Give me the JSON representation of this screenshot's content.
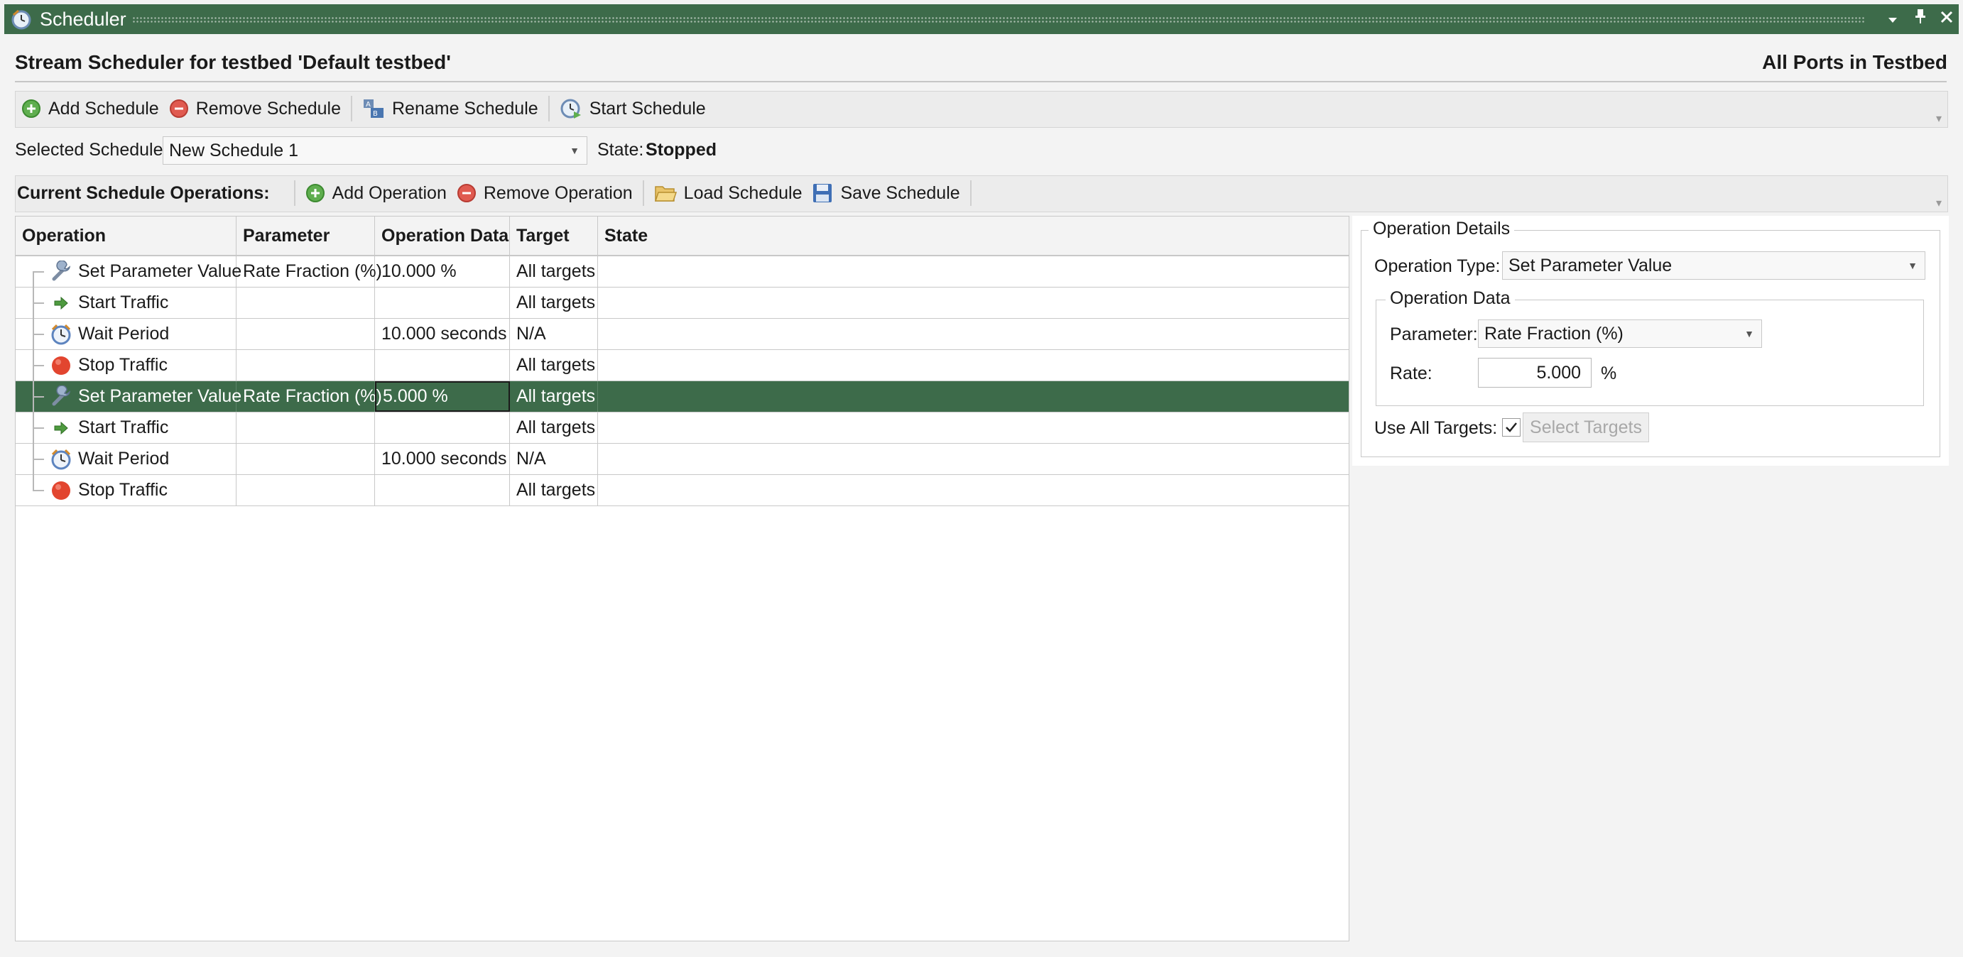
{
  "window": {
    "title": "Scheduler",
    "icon": "scheduler-clock-icon"
  },
  "header": {
    "title": "Stream Scheduler for testbed 'Default testbed'",
    "scope": "All Ports in Testbed"
  },
  "schedule_toolbar": {
    "add": "Add Schedule",
    "remove": "Remove Schedule",
    "rename": "Rename Schedule",
    "start": "Start Schedule"
  },
  "selection": {
    "label": "Selected Schedule:",
    "value": "New Schedule 1",
    "state_label": "State:",
    "state_value": "Stopped"
  },
  "operations_toolbar": {
    "label": "Current Schedule Operations:",
    "add": "Add Operation",
    "remove": "Remove Operation",
    "load": "Load Schedule",
    "save": "Save Schedule"
  },
  "grid": {
    "columns": [
      "Operation",
      "Parameter",
      "Operation Data",
      "Target",
      "State"
    ],
    "rows": [
      {
        "icon": "wrench-icon",
        "operation": "Set Parameter Value",
        "parameter": "Rate Fraction (%)",
        "data": "10.000 %",
        "target": "All targets",
        "state": ""
      },
      {
        "icon": "green-arrow-icon",
        "operation": "Start Traffic",
        "parameter": "",
        "data": "",
        "target": "All targets",
        "state": ""
      },
      {
        "icon": "alarm-clock-icon",
        "operation": "Wait Period",
        "parameter": "",
        "data": "10.000 seconds",
        "target": "N/A",
        "state": ""
      },
      {
        "icon": "stop-red-icon",
        "operation": "Stop Traffic",
        "parameter": "",
        "data": "",
        "target": "All targets",
        "state": ""
      },
      {
        "icon": "wrench-icon",
        "operation": "Set Parameter Value",
        "parameter": "Rate Fraction (%)",
        "data": "5.000 %",
        "target": "All targets",
        "state": "",
        "selected": true
      },
      {
        "icon": "green-arrow-icon",
        "operation": "Start Traffic",
        "parameter": "",
        "data": "",
        "target": "All targets",
        "state": ""
      },
      {
        "icon": "alarm-clock-icon",
        "operation": "Wait Period",
        "parameter": "",
        "data": "10.000 seconds",
        "target": "N/A",
        "state": ""
      },
      {
        "icon": "stop-red-icon",
        "operation": "Stop Traffic",
        "parameter": "",
        "data": "",
        "target": "All targets",
        "state": ""
      }
    ]
  },
  "details": {
    "group_title": "Operation Details",
    "type_label": "Operation Type:",
    "type_value": "Set Parameter Value",
    "data_group_title": "Operation Data",
    "parameter_label": "Parameter:",
    "parameter_value": "Rate Fraction (%)",
    "rate_label": "Rate:",
    "rate_value": "5.000",
    "rate_unit": "%",
    "use_all_label": "Use All Targets:",
    "use_all_checked": true,
    "select_targets": "Select Targets"
  },
  "colors": {
    "accent": "#3d6b4a",
    "background": "#f3f3f3",
    "grid_line": "#c8c8c8"
  }
}
